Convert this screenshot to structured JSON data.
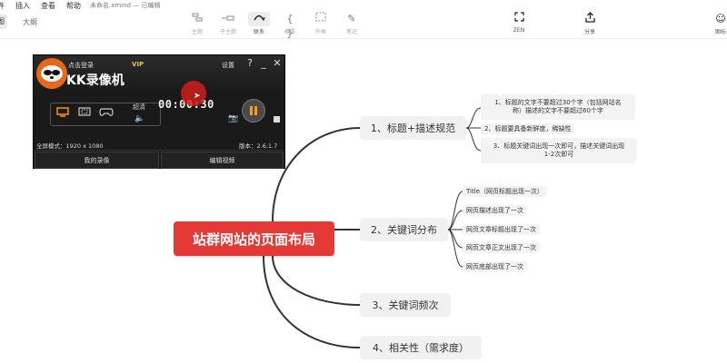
{
  "menubar": {
    "items": [
      "件",
      "插入",
      "查看",
      "帮助"
    ],
    "doc_title": "未命名.xmind — 已编辑"
  },
  "views": {
    "active": "图",
    "outline": "大纲"
  },
  "toolbar": {
    "topic": "主题",
    "subtopic": "子主题",
    "relation": "联系",
    "summary": "概要",
    "boundary": "外框",
    "note": "笔记",
    "zen": "ZEN",
    "share": "分享",
    "right": "图标"
  },
  "mindmap": {
    "central": "站群网站的页面布局",
    "branches": [
      {
        "label": "1、标题+描述规范",
        "children": [
          [
            "1、标题的文字不要超过30个字（包括网站名",
            "称）描述的文字不要超过60个字"
          ],
          [
            "2、标题要具备新鲜度，稀缺性"
          ],
          [
            "3、标题关键词出现一次即可，描述关键词出现",
            "1-2次即可"
          ]
        ]
      },
      {
        "label": "2、关键词分布",
        "children": [
          [
            "Title（网页标题出现一次）"
          ],
          [
            "网页描述出现了一次"
          ],
          [
            "网页文章标题出现了一次"
          ],
          [
            "网页文章正文出现了一次"
          ],
          [
            "网页底部出现了一次"
          ]
        ]
      },
      {
        "label": "3、关键词频次",
        "children": []
      },
      {
        "label": "4、相关性（需求度）",
        "children": []
      }
    ]
  },
  "recorder": {
    "login": "点击登录",
    "vip": "VIP",
    "app_name": "KK录像机",
    "settings": "设置",
    "help": "?",
    "minimize": "_",
    "close": "✕",
    "quality": "超清",
    "timer": "00:00:30",
    "resolution": "全屏模式：1920 x 1080",
    "version": "版本：2.6.1.7",
    "my_recordings": "我的录像",
    "edit_video": "编辑视频"
  },
  "colors": {
    "central": "#e53935",
    "branch_bg": "#f1f1f1",
    "line": "#333333",
    "recorder_bg": "#1a1a1a",
    "accent": "#ff9800"
  }
}
